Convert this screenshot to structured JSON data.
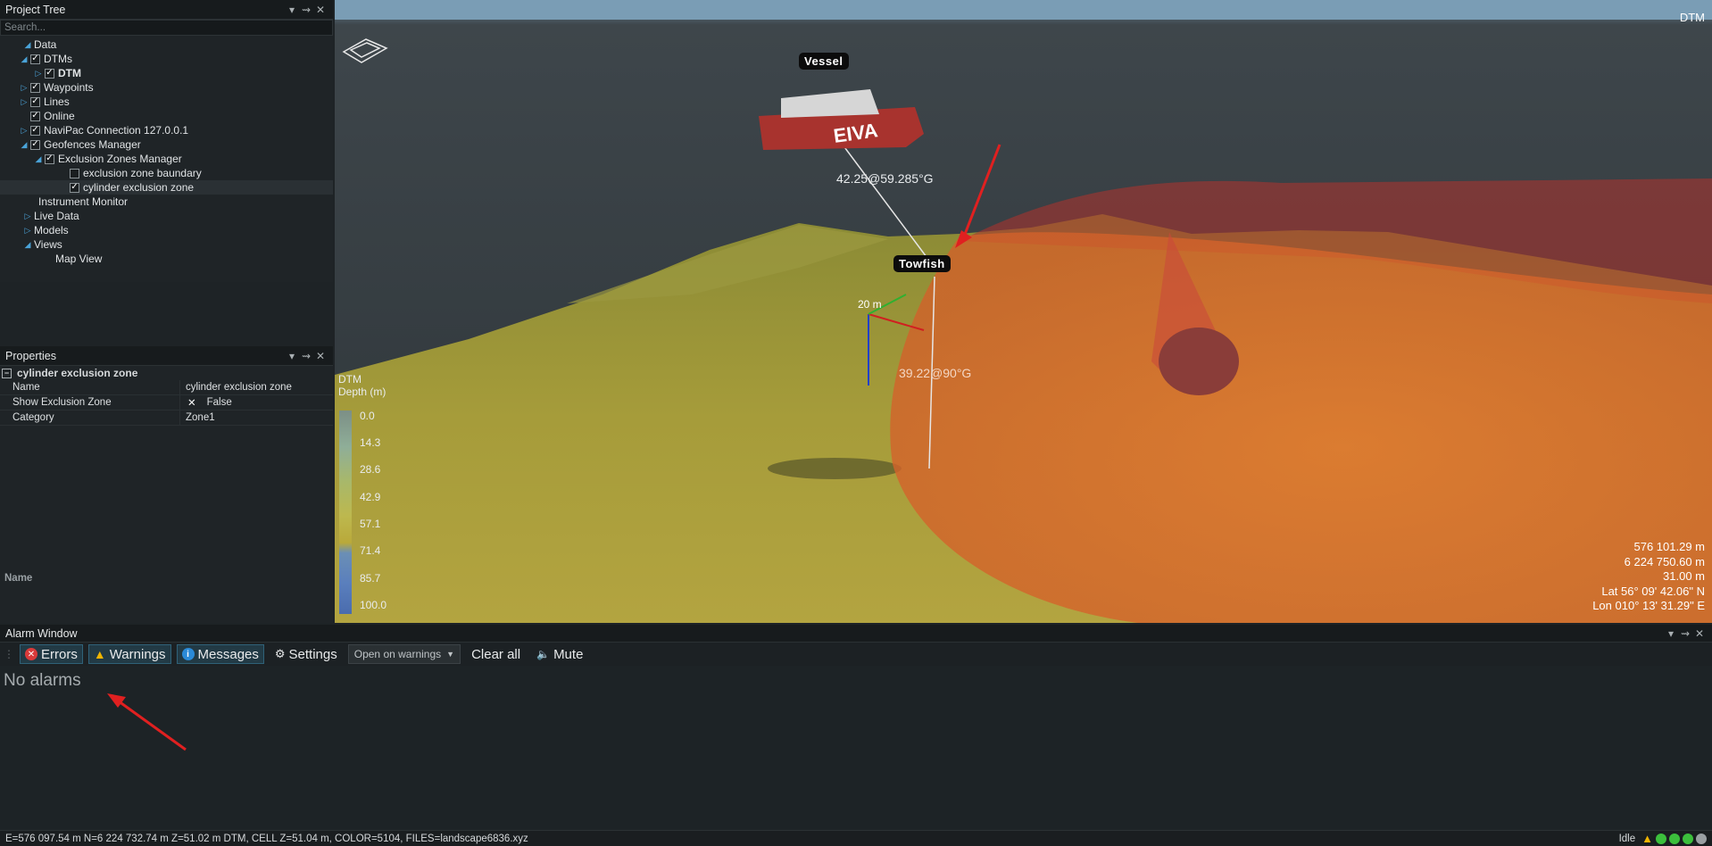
{
  "project_tree": {
    "title": "Project Tree",
    "search_placeholder": "Search...",
    "items": [
      {
        "label": "Data"
      },
      {
        "label": "DTMs"
      },
      {
        "label": "DTM"
      },
      {
        "label": "Waypoints"
      },
      {
        "label": "Lines"
      },
      {
        "label": "Online"
      },
      {
        "label": "NaviPac Connection 127.0.0.1"
      },
      {
        "label": "Geofences Manager"
      },
      {
        "label": "Exclusion Zones Manager"
      },
      {
        "label": "exclusion zone baundary"
      },
      {
        "label": "cylinder exclusion zone"
      },
      {
        "label": "Instrument Monitor"
      },
      {
        "label": "Live Data"
      },
      {
        "label": "Models"
      },
      {
        "label": "Views"
      },
      {
        "label": "Map View"
      }
    ]
  },
  "properties": {
    "title": "Properties",
    "object_name": "cylinder exclusion zone",
    "rows": [
      {
        "key": "Name",
        "value": "cylinder exclusion zone"
      },
      {
        "key": "Show Exclusion Zone",
        "value": "False"
      },
      {
        "key": "Category",
        "value": "Zone1"
      }
    ],
    "description_label": "Name"
  },
  "viewport": {
    "corner_label": "DTM",
    "vessel_label": "Vessel",
    "towfish_label": "Towfish",
    "hull_text": "EIVA",
    "vessel_range": "42.25@59.285°G",
    "towfish_range": "39.22@90°G",
    "scale_label": "20 m",
    "legend": {
      "title": "DTM",
      "subtitle": "Depth (m)",
      "values": [
        "0.0",
        "14.3",
        "28.6",
        "42.9",
        "57.1",
        "71.4",
        "85.7",
        "100.0"
      ],
      "colors": [
        "#7c8f86",
        "#8fae98",
        "#a8b86a",
        "#bdb84e",
        "#b9a93a",
        "#6b8fb5",
        "#5a7fbd",
        "#4a6cae"
      ]
    },
    "coords": [
      "576 101.29 m",
      "6 224 750.60 m",
      "31.00 m",
      "Lat 56° 09' 42.06\" N",
      "Lon 010° 13' 31.29\" E"
    ]
  },
  "alarm_window": {
    "title": "Alarm Window",
    "errors": "Errors",
    "warnings": "Warnings",
    "messages": "Messages",
    "settings": "Settings",
    "dropdown_value": "Open on warnings",
    "clear_all": "Clear all",
    "mute": "Mute",
    "empty_text": "No alarms"
  },
  "status_bar": {
    "text": "E=576 097.54 m N=6 224 732.74 m Z=51.02 m DTM, CELL Z=51.04 m, COLOR=5104, FILES=landscape6836.xyz",
    "state": "Idle"
  }
}
